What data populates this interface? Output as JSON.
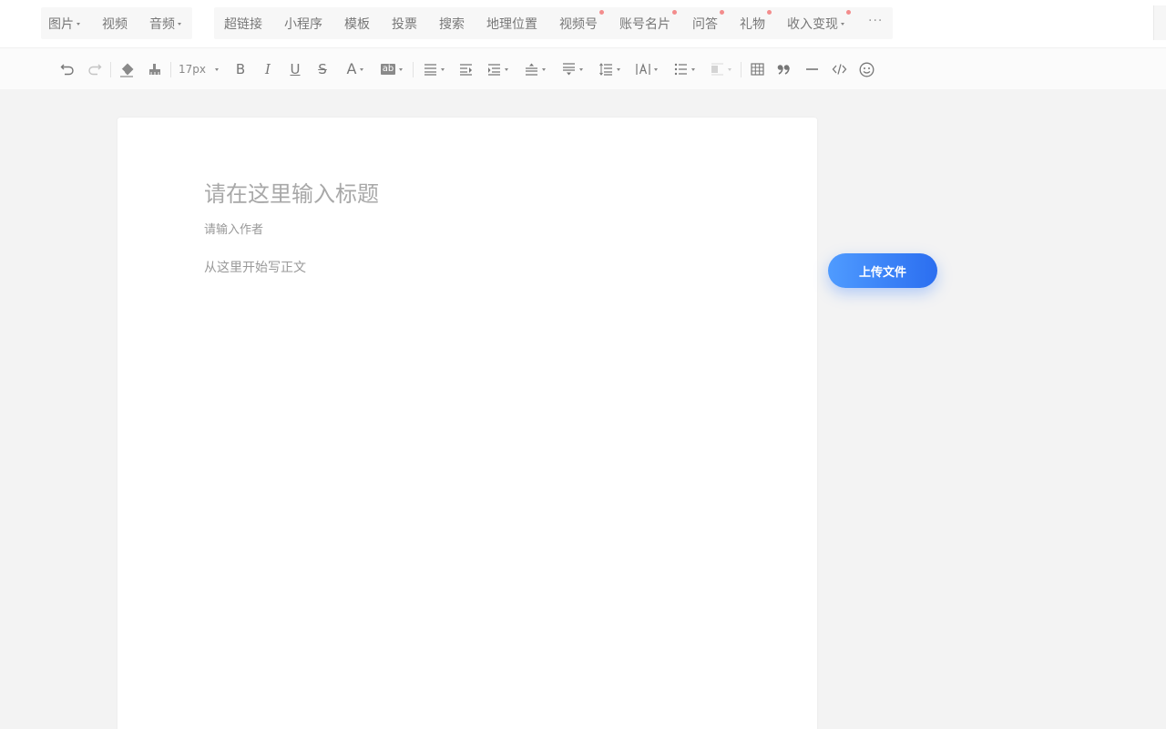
{
  "insert_bar": {
    "media": [
      {
        "label": "图片",
        "dropdown": true
      },
      {
        "label": "视频",
        "dropdown": false
      },
      {
        "label": "音频",
        "dropdown": true
      }
    ],
    "components": [
      {
        "label": "超链接",
        "dot": false,
        "dropdown": false
      },
      {
        "label": "小程序",
        "dot": false,
        "dropdown": false
      },
      {
        "label": "模板",
        "dot": false,
        "dropdown": false
      },
      {
        "label": "投票",
        "dot": false,
        "dropdown": false
      },
      {
        "label": "搜索",
        "dot": false,
        "dropdown": false
      },
      {
        "label": "地理位置",
        "dot": false,
        "dropdown": false
      },
      {
        "label": "视频号",
        "dot": true,
        "dropdown": false
      },
      {
        "label": "账号名片",
        "dot": true,
        "dropdown": false
      },
      {
        "label": "问答",
        "dot": true,
        "dropdown": false
      },
      {
        "label": "礼物",
        "dot": true,
        "dropdown": false
      },
      {
        "label": "收入变现",
        "dot": true,
        "dropdown": true
      }
    ],
    "more_label": "···",
    "dot_color": "#f38c8c"
  },
  "toolbar": {
    "font_size": "17px",
    "icons": [
      "undo-icon",
      "redo-icon",
      "clear-format-icon",
      "format-painter-icon",
      "font-size-select",
      "bold-icon",
      "italic-icon",
      "underline-icon",
      "strikethrough-icon",
      "font-color-icon",
      "background-color-icon",
      "align-icon",
      "indent-icon",
      "first-line-indent-icon",
      "paragraph-spacing-before-icon",
      "paragraph-spacing-after-icon",
      "line-height-icon",
      "letter-spacing-icon",
      "list-icon",
      "border-shading-icon",
      "table-icon",
      "quote-icon",
      "divider-icon",
      "code-icon",
      "emoji-icon"
    ],
    "glyphs": {
      "bold": "B",
      "italic": "I",
      "underline": "U",
      "strike": "S",
      "font_color": "A",
      "bg_color": "ab"
    }
  },
  "editor": {
    "title_placeholder": "请在这里输入标题",
    "author_placeholder": "请输入作者",
    "body_placeholder": "从这里开始写正文"
  },
  "upload_button": {
    "label": "上传文件",
    "accent": "#3b82f6"
  }
}
